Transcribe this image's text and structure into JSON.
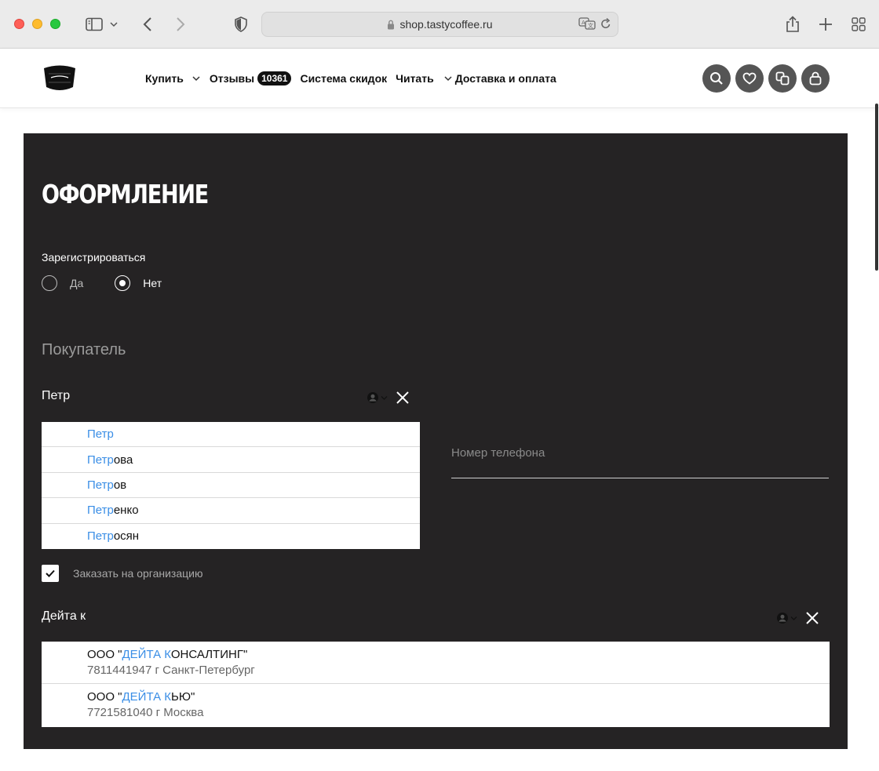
{
  "browser": {
    "url": "shop.tastycoffee.ru"
  },
  "header": {
    "nav": [
      {
        "label": "Купить",
        "dropdown": true
      },
      {
        "label": "Отзывы",
        "badge": "10361"
      },
      {
        "label": "Система скидок"
      },
      {
        "label": "Читать",
        "dropdown": true
      },
      {
        "label": "Доставка и оплата"
      }
    ]
  },
  "checkout": {
    "title": "ОФОРМЛЕНИЕ",
    "register_label": "Зарегистрироваться",
    "register_options": [
      "Да",
      "Нет"
    ],
    "register_selected": "Нет",
    "buyer_section": "Покупатель",
    "name_value": "Петр",
    "name_suggestions": [
      {
        "match": "Петр",
        "rest": ""
      },
      {
        "match": "Петр",
        "rest": "ова"
      },
      {
        "match": "Петр",
        "rest": "ов"
      },
      {
        "match": "Петр",
        "rest": "енко"
      },
      {
        "match": "Петр",
        "rest": "осян"
      }
    ],
    "phone_placeholder": "Номер телефона",
    "org_checkbox_label": "Заказать на организацию",
    "org_checked": true,
    "org_value": "Дейта к",
    "org_suggestions": [
      {
        "prefix": "ООО \"",
        "match": "ДЕЙТА К",
        "rest": "ОНСАЛТИНГ\"",
        "meta": "7811441947  г Санкт-Петербург"
      },
      {
        "prefix": "ООО \"",
        "match": "ДЕЙТА К",
        "rest": "ЬЮ\"",
        "meta": "7721581040  г Москва"
      }
    ]
  },
  "colors": {
    "panel_bg": "#252324",
    "highlight": "#3a8ee6"
  }
}
